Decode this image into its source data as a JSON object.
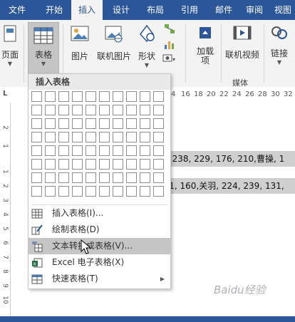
{
  "tabs": [
    "文件",
    "开始",
    "插入",
    "设计",
    "布局",
    "引用",
    "邮件",
    "审阅",
    "视图"
  ],
  "active_tab": "插入",
  "ribbon": {
    "page_btn": "页面",
    "table_btn": "表格",
    "picture_btn": "图片",
    "online_picture_btn": "联机图片",
    "shapes_btn": "形状",
    "addins_btn": "加载\n项",
    "online_video_btn": "联机视频",
    "link_btn": "链接",
    "media_group": "媒体"
  },
  "ruler_numbers": [
    "4",
    "16",
    "18",
    "20",
    "22",
    "24",
    "26",
    "28",
    "30",
    "32",
    "34",
    "3"
  ],
  "ruler_marker": "L",
  "vruler_numbers": [
    "2",
    "1",
    "1",
    "2",
    "3",
    "4",
    "5",
    "6",
    "7",
    "8",
    "9",
    "10",
    "11",
    "12"
  ],
  "document": {
    "line1": "权, 238, 229, 176, 210,曹操, 1",
    "line2": "201, 160,关羽, 224, 239, 131,"
  },
  "menu": {
    "header": "插入表格",
    "grid_cols": 10,
    "grid_rows": 8,
    "items": [
      {
        "label": "插入表格(I)...",
        "icon": "insert-table-icon"
      },
      {
        "label": "绘制表格(D)",
        "icon": "draw-table-icon"
      },
      {
        "label": "文本转换成表格(V)...",
        "icon": "convert-text-icon"
      },
      {
        "label": "Excel 电子表格(X)",
        "icon": "excel-icon"
      },
      {
        "label": "快速表格(T)",
        "icon": "quick-table-icon"
      }
    ],
    "highlighted_index": 2
  },
  "watermark": "Baidu经验",
  "colors": {
    "brand": "#2b579a",
    "highlight": "#c5c5c5",
    "excel": "#217346"
  }
}
